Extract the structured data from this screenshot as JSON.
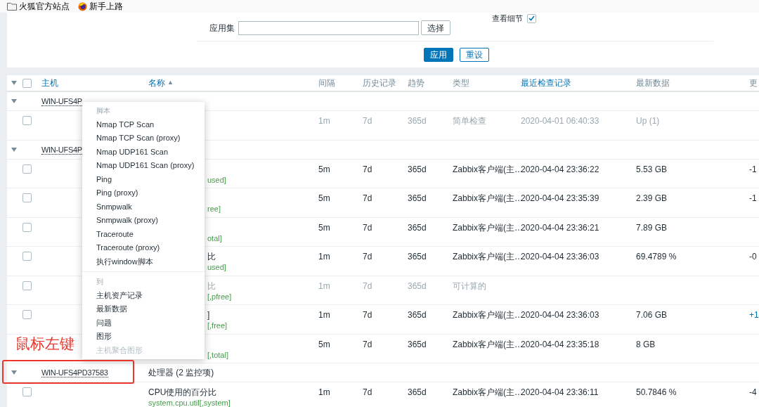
{
  "bookmarks": [
    {
      "label": "火狐官方站点",
      "kind": "folder"
    },
    {
      "label": "新手上路",
      "kind": "browser"
    }
  ],
  "filter": {
    "view_details": {
      "label": "查看细节",
      "checked": true
    },
    "application": {
      "label": "应用集",
      "button": "选择"
    },
    "buttons": [
      {
        "label": "应用",
        "kind": "primary"
      },
      {
        "label": "重设",
        "kind": "secondary"
      }
    ]
  },
  "table": {
    "select_all": {
      "checked": false
    },
    "columns": [
      {
        "label": "主机",
        "link": true
      },
      {
        "label": "名称",
        "link": true,
        "sort_mark": "▲"
      },
      {
        "label": "间隔",
        "link": false
      },
      {
        "label": "历史记录",
        "link": false
      },
      {
        "label": "趋势",
        "link": false
      },
      {
        "label": "类型",
        "link": false
      },
      {
        "label": "最近检查记录",
        "link": true
      },
      {
        "label": "最新数据",
        "link": false
      },
      {
        "label": "更",
        "link": false
      }
    ],
    "groups": [
      {
        "host": "WIN-UFS4P",
        "expanded": true,
        "items": [
          {
            "checked": false,
            "inactive": true,
            "interval": "1m",
            "history": "7d",
            "trends": "365d",
            "type": "简单检查",
            "last_check": "2020-04-01 06:40:33",
            "last_value": "Up (1)"
          }
        ]
      },
      {
        "host": "WIN-UFS4P",
        "expanded": true,
        "items": [
          {
            "checked": false,
            "inactive": false,
            "key": "used]",
            "interval": "5m",
            "history": "7d",
            "trends": "365d",
            "type": "Zabbix客户端(主…",
            "last_check": "2020-04-04 23:36:22",
            "last_value": "5.53 GB",
            "change": "-1"
          },
          {
            "checked": false,
            "inactive": false,
            "key": "ree]",
            "interval": "5m",
            "history": "7d",
            "trends": "365d",
            "type": "Zabbix客户端(主…",
            "last_check": "2020-04-04 23:35:39",
            "last_value": "2.39 GB",
            "change": "-1"
          },
          {
            "checked": false,
            "inactive": false,
            "key": "otal]",
            "interval": "5m",
            "history": "7d",
            "trends": "365d",
            "type": "Zabbix客户端(主…",
            "last_check": "2020-04-04 23:36:21",
            "last_value": "7.89 GB"
          },
          {
            "checked": false,
            "inactive": false,
            "name": "比",
            "key": "used]",
            "interval": "1m",
            "history": "7d",
            "trends": "365d",
            "type": "Zabbix客户端(主…",
            "last_check": "2020-04-04 23:36:03",
            "last_value": "69.4789 %",
            "change": "-0"
          },
          {
            "checked": false,
            "inactive": true,
            "name": "比",
            "key": "[,pfree]",
            "interval": "1m",
            "history": "7d",
            "trends": "365d",
            "type": "可计算的"
          },
          {
            "checked": false,
            "inactive": false,
            "name": "]",
            "key": "[,free]",
            "interval": "1m",
            "history": "7d",
            "trends": "365d",
            "type": "Zabbix客户端(主…",
            "last_check": "2020-04-04 23:36:03",
            "last_value": "7.06 GB",
            "change": "+1"
          },
          {
            "inactive": false,
            "key": "[,total]",
            "interval": "5m",
            "history": "7d",
            "trends": "365d",
            "type": "Zabbix客户端(主…",
            "last_check": "2020-04-04 23:35:18",
            "last_value": "8 GB"
          }
        ]
      },
      {
        "host": "WIN-UFS4PD37583",
        "application": "处理器 (2 监控项)",
        "expanded": true,
        "items": [
          {
            "checked": false,
            "inactive": false,
            "full": true,
            "name": "CPU使用的百分比",
            "key": "system.cpu.util[,system]",
            "interval": "1m",
            "history": "7d",
            "trends": "365d",
            "type": "Zabbix客户端(主…",
            "last_check": "2020-04-04 23:36:11",
            "last_value": "50.7846 %",
            "change": "-4"
          }
        ]
      }
    ]
  },
  "context_menu": {
    "sections": [
      {
        "header": "脚本",
        "items": [
          "Nmap TCP Scan",
          "Nmap TCP Scan (proxy)",
          "Nmap UDP161 Scan",
          "Nmap UDP161 Scan (proxy)",
          "Ping",
          "Ping (proxy)",
          "Snmpwalk",
          "Snmpwalk (proxy)",
          "Traceroute",
          "Traceroute (proxy)",
          "执行window脚本"
        ]
      },
      {
        "header": "到",
        "items": [
          "主机资产记录",
          "最新数据",
          "问题",
          "图形",
          "主机聚合图形"
        ]
      }
    ]
  },
  "annotation": {
    "text": "鼠标左键"
  }
}
